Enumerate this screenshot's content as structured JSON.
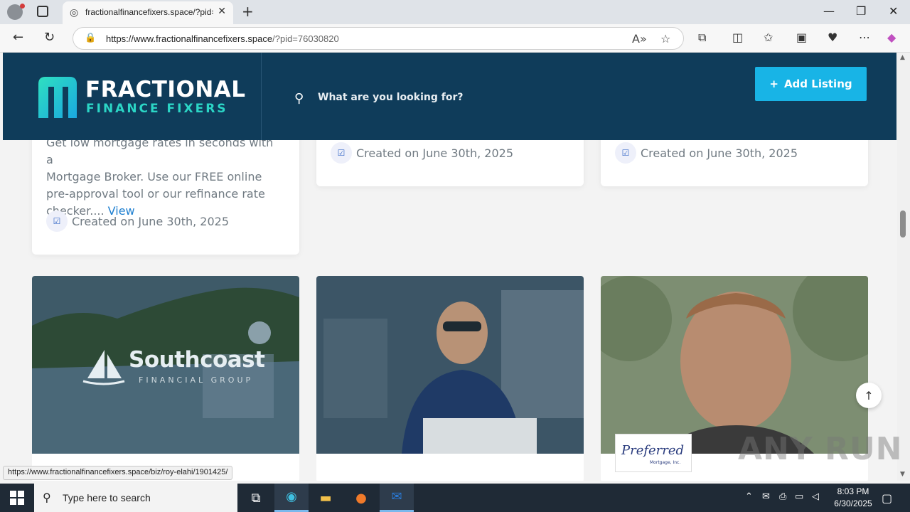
{
  "browser": {
    "tab_title": "fractionalfinancefixers.space/?pid=76030820",
    "url_host": "https://www.fractionalfinancefixers.space",
    "url_path": "/?pid=76030820",
    "status_url": "https://www.fractionalfinancefixers.space/biz/roy-elahi/1901425/"
  },
  "header": {
    "logo_line1": "FRACTIONAL",
    "logo_line2": "FINANCE FIXERS",
    "search_placeholder": "What are you looking for?",
    "add_listing_label": "Add Listing"
  },
  "cards": {
    "left": {
      "desc_line0": "Get low mortgage rates in seconds with a",
      "desc_rest": "Mortgage Broker. Use our FREE online pre-approval tool or our refinance rate checker....",
      "view_label": "View",
      "created": "Created on June 30th, 2025"
    },
    "middle": {
      "created": "Created on June 30th, 2025"
    },
    "right": {
      "created": "Created on June 30th, 2025"
    }
  },
  "listings": {
    "southcoast_name": "Southcoast",
    "southcoast_sub": "FINANCIAL GROUP",
    "preferred_name": "Preferred",
    "preferred_sub": "Mortgage, Inc."
  },
  "watermark": "ANY RUN",
  "taskbar": {
    "search_placeholder": "Type here to search",
    "time": "8:03 PM",
    "date": "6/30/2025"
  },
  "colors": {
    "header_bg": "#0f3c5a",
    "accent": "#18b4e6",
    "logo_teal": "#2bd6c6"
  }
}
